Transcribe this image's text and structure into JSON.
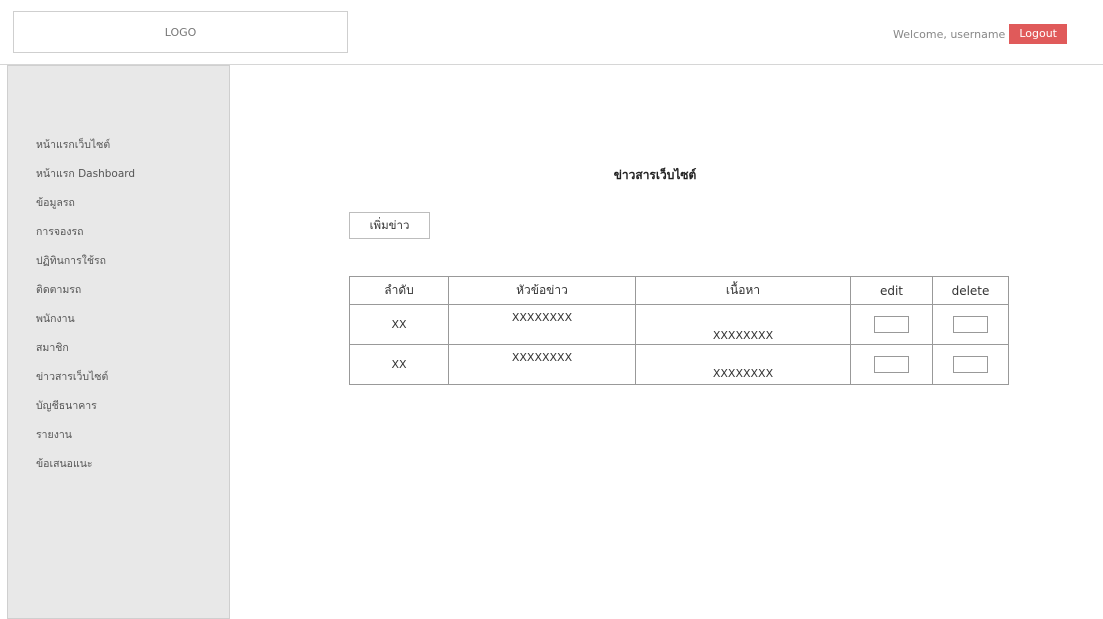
{
  "header": {
    "logo_text": "LOGO",
    "welcome_text": "Welcome, username",
    "logout_label": "Logout"
  },
  "sidebar": {
    "items": [
      {
        "label": "หน้าแรกเว็บไซต์"
      },
      {
        "label": "หน้าแรก Dashboard"
      },
      {
        "label": "ข้อมูลรถ"
      },
      {
        "label": "การจองรถ"
      },
      {
        "label": "ปฏิทินการใช้รถ"
      },
      {
        "label": "ติดตามรถ"
      },
      {
        "label": "พนักงาน"
      },
      {
        "label": "สมาชิก"
      },
      {
        "label": "ข่าวสารเว็บไซต์"
      },
      {
        "label": "บัญชีธนาคาร"
      },
      {
        "label": "รายงาน"
      },
      {
        "label": "ข้อเสนอแนะ"
      }
    ]
  },
  "main": {
    "title": "ข่าวสารเว็บไซต์",
    "add_button_label": "เพิ่มข่าว",
    "table": {
      "columns": [
        "ลำดับ",
        "หัวข้อข่าว",
        "เนื้อหา",
        "edit",
        "delete"
      ],
      "rows": [
        {
          "no": "XX",
          "headline": "XXXXXXXX",
          "content": "XXXXXXXX"
        },
        {
          "no": "XX",
          "headline": "XXXXXXXX",
          "content": "XXXXXXXX"
        }
      ]
    }
  },
  "colors": {
    "logout_bg": "#e05a5a",
    "sidebar_bg": "#e8e8e8"
  }
}
